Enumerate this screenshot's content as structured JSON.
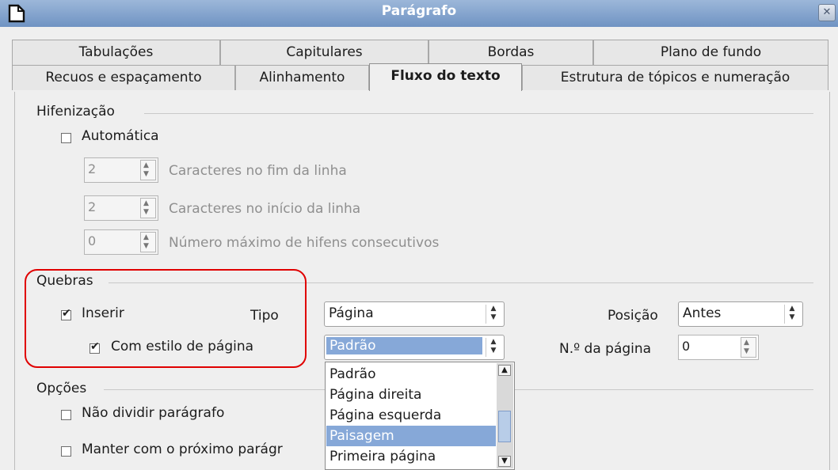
{
  "window": {
    "title": "Parágrafo",
    "close_glyph": "✕",
    "accent_color": "#7b9cca"
  },
  "tabs_row1": [
    {
      "label": "Tabulações"
    },
    {
      "label": "Capitulares"
    },
    {
      "label": "Bordas"
    },
    {
      "label": "Plano de fundo"
    }
  ],
  "tabs_row2": [
    {
      "label": "Recuos e espaçamento"
    },
    {
      "label": "Alinhamento"
    },
    {
      "label": "Fluxo do texto",
      "active": true
    },
    {
      "label": "Estrutura de tópicos e numeração"
    }
  ],
  "hyphenation": {
    "section_label": "Hifenização",
    "automatic_label": "Automática",
    "automatic_checked": false,
    "chars_end_value": "2",
    "chars_end_label": "Caracteres no fim da linha",
    "chars_start_value": "2",
    "chars_start_label": "Caracteres no início da linha",
    "max_hyphens_value": "0",
    "max_hyphens_label": "Número máximo de hifens consecutivos"
  },
  "breaks": {
    "section_label": "Quebras",
    "insert_label": "Inserir",
    "insert_checked": true,
    "type_label": "Tipo",
    "type_value": "Página",
    "position_label": "Posição",
    "position_value": "Antes",
    "page_style_label": "Com estilo de página",
    "page_style_checked": true,
    "page_style_value": "Padrão",
    "page_number_label": "N.º da página",
    "page_number_value": "0",
    "highlight_color": "#e00000"
  },
  "page_style_options": [
    {
      "label": "Padrão"
    },
    {
      "label": "Página direita"
    },
    {
      "label": "Página esquerda"
    },
    {
      "label": "Paisagem",
      "selected": true
    },
    {
      "label": "Primeira página"
    }
  ],
  "options": {
    "section_label": "Opções",
    "dont_split_label": "Não dividir parágrafo",
    "keep_next_label": "Manter com o próximo parágr"
  }
}
